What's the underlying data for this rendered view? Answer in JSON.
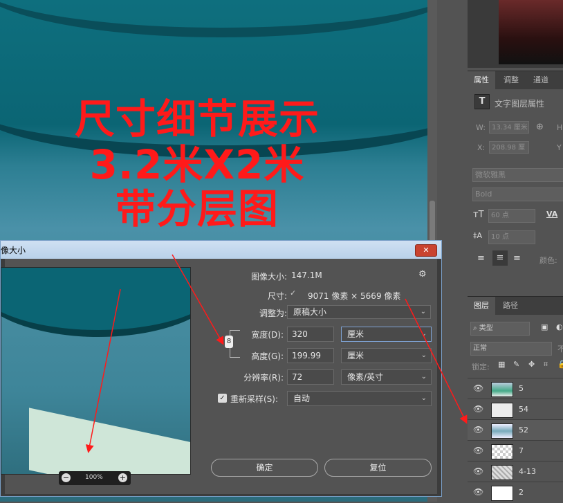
{
  "canvas_text": {
    "line1": "尺寸细节展示",
    "line2": "3.2米X2米",
    "line3": "带分层图"
  },
  "properties_panel": {
    "tabs": [
      "属性",
      "调整",
      "通道"
    ],
    "layer_type_label": "文字图层属性",
    "w_label": "W:",
    "w_value": "13.34 厘米",
    "h_label": "H",
    "x_label": "X:",
    "x_value": "208.98 厘",
    "y_label": "Y",
    "font_family": "微软雅黑",
    "font_style": "Bold",
    "font_size": "60 点",
    "leading": "10 点",
    "va_label": "VA",
    "color_label": "颜色:"
  },
  "layers_panel": {
    "tabs": [
      "图层",
      "路径"
    ],
    "filter_label": "类型",
    "blend_mode": "正常",
    "opacity_label": "不",
    "lock_label": "锁定:",
    "layers": [
      {
        "name": "5"
      },
      {
        "name": "54"
      },
      {
        "name": "52"
      },
      {
        "name": "7"
      },
      {
        "name": "4-13"
      },
      {
        "name": "2"
      }
    ]
  },
  "dialog": {
    "title": "像大小",
    "image_size_label": "图像大小:",
    "image_size_value": "147.1M",
    "dimensions_label": "尺寸:",
    "dimensions_value": "9071 像素 × 5669 像素",
    "fit_label": "调整为:",
    "fit_value": "原稿大小",
    "width_label": "宽度(D):",
    "width_value": "320",
    "width_unit": "厘米",
    "height_label": "高度(G):",
    "height_value": "199.99",
    "height_unit": "厘米",
    "resolution_label": "分辨率(R):",
    "resolution_value": "72",
    "resolution_unit": "像素/英寸",
    "resample_label": "重新采样(S):",
    "resample_value": "自动",
    "zoom_value": "100%",
    "ok_label": "确定",
    "reset_label": "复位"
  },
  "colors": {
    "annotation_red": "#ff1a1a",
    "canvas_teal": "#0b6574",
    "panel_bg": "#535353",
    "dialog_titlebar": "#c4d8ee"
  }
}
